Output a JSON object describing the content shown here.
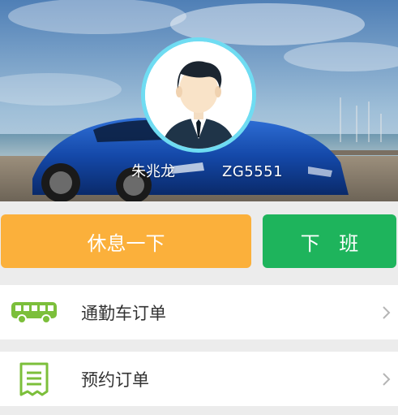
{
  "profile": {
    "name": "朱兆龙",
    "id": "ZG5551"
  },
  "actions": {
    "rest_label": "休息一下",
    "off_duty_label": "下 班"
  },
  "menu": {
    "items": [
      {
        "label": "通勤车订单",
        "icon": "bus-icon"
      },
      {
        "label": "预约订单",
        "icon": "receipt-icon"
      }
    ]
  },
  "colors": {
    "rest_button": "#fbb03b",
    "off_duty_button": "#1eb45c",
    "avatar_ring": "#6fdcf2",
    "icon_green": "#7cbf3b"
  }
}
